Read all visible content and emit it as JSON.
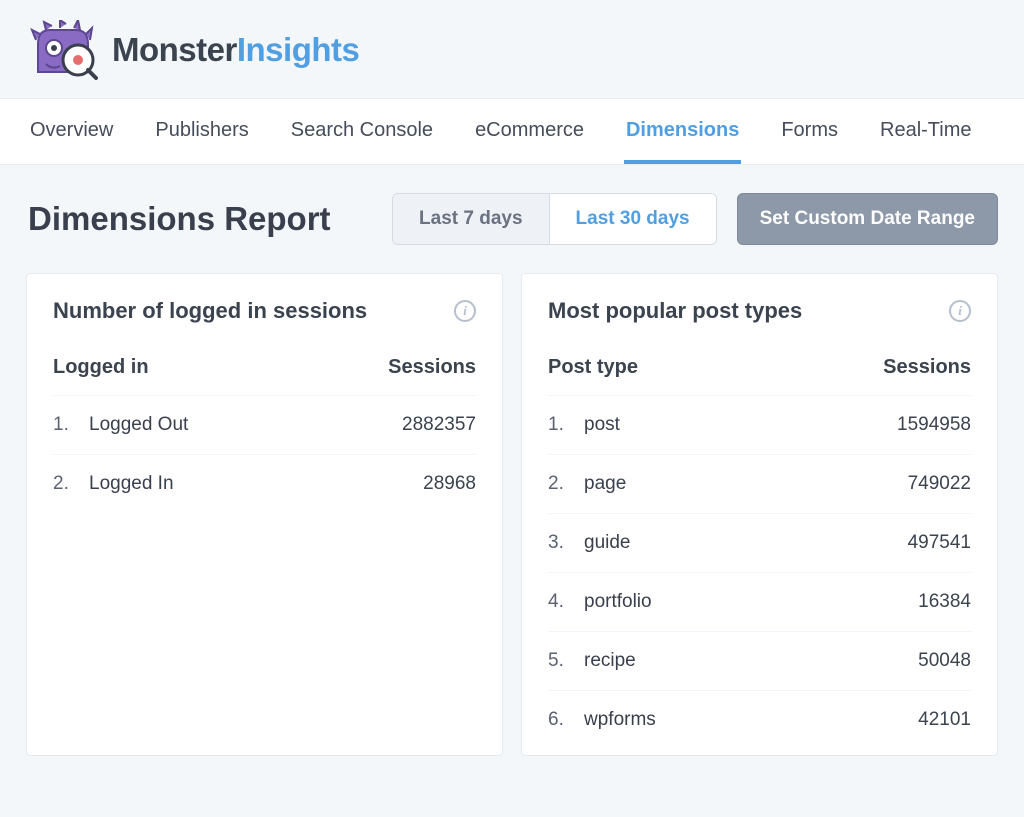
{
  "brand": {
    "part1": "Monster",
    "part2": "Insights"
  },
  "nav": {
    "items": [
      {
        "label": "Overview"
      },
      {
        "label": "Publishers"
      },
      {
        "label": "Search Console"
      },
      {
        "label": "eCommerce"
      },
      {
        "label": "Dimensions",
        "active": true
      },
      {
        "label": "Forms"
      },
      {
        "label": "Real-Time"
      }
    ]
  },
  "page_title": "Dimensions Report",
  "range": {
    "options": [
      {
        "label": "Last 7 days"
      },
      {
        "label": "Last 30 days",
        "active": true
      }
    ],
    "custom_label": "Set Custom Date Range"
  },
  "cards": [
    {
      "title": "Number of logged in sessions",
      "col1": "Logged in",
      "col2": "Sessions",
      "rows": [
        {
          "n": "1.",
          "name": "Logged Out",
          "value": "2882357"
        },
        {
          "n": "2.",
          "name": "Logged In",
          "value": "28968"
        }
      ]
    },
    {
      "title": "Most popular post types",
      "col1": "Post type",
      "col2": "Sessions",
      "rows": [
        {
          "n": "1.",
          "name": "post",
          "value": "1594958"
        },
        {
          "n": "2.",
          "name": "page",
          "value": "749022"
        },
        {
          "n": "3.",
          "name": "guide",
          "value": "497541"
        },
        {
          "n": "4.",
          "name": "portfolio",
          "value": "16384"
        },
        {
          "n": "5.",
          "name": "recipe",
          "value": "50048"
        },
        {
          "n": "6.",
          "name": "wpforms",
          "value": "42101"
        }
      ]
    }
  ]
}
